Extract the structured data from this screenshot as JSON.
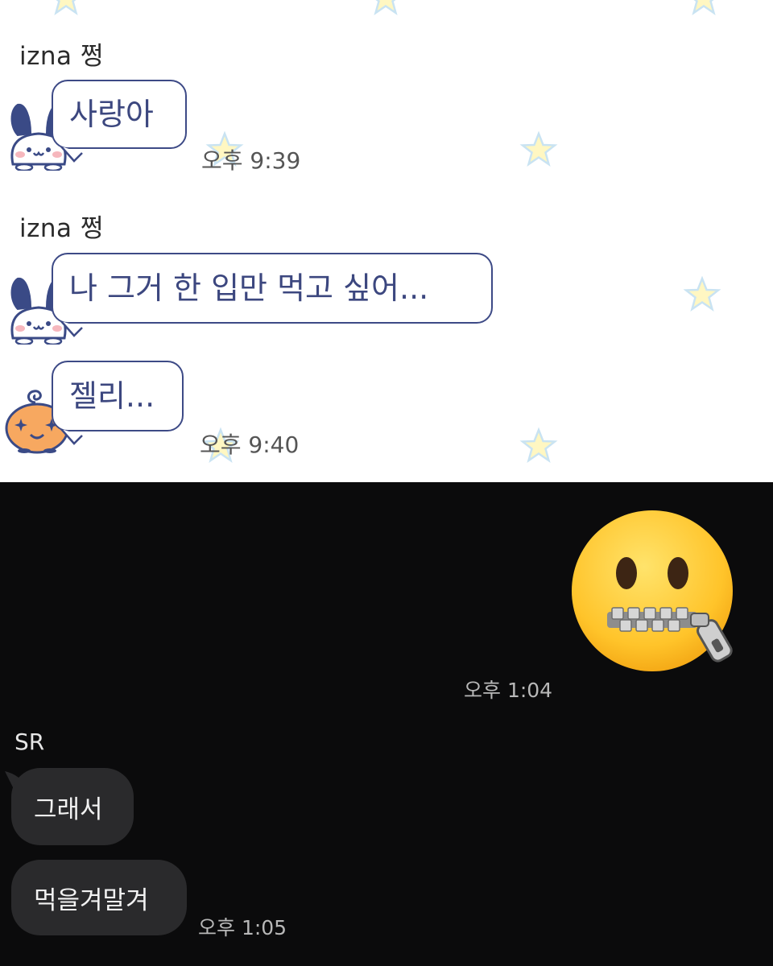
{
  "top_chat": {
    "messages": [
      {
        "sender": "izna 쩡",
        "text": "사랑아",
        "time": "오후 9:39"
      },
      {
        "sender": "izna 쩡",
        "text": "나 그거 한 입만 먹고 싶어...",
        "time": ""
      },
      {
        "sender": "",
        "text": "젤리...",
        "time": "오후 9:40"
      }
    ],
    "colors": {
      "bubble_border": "#3d4a86",
      "bubble_text": "#3c477f",
      "star": "#fff7c2"
    }
  },
  "bottom_chat": {
    "sent_emoji": {
      "icon": "zipper-mouth-face-emoji",
      "time": "오후 1:04"
    },
    "sender": "SR",
    "messages": [
      {
        "text": "그래서"
      },
      {
        "text": "먹을겨말겨",
        "time": "오후 1:05"
      }
    ],
    "colors": {
      "background": "#0b0b0c",
      "bubble": "#2a2a2c"
    }
  }
}
